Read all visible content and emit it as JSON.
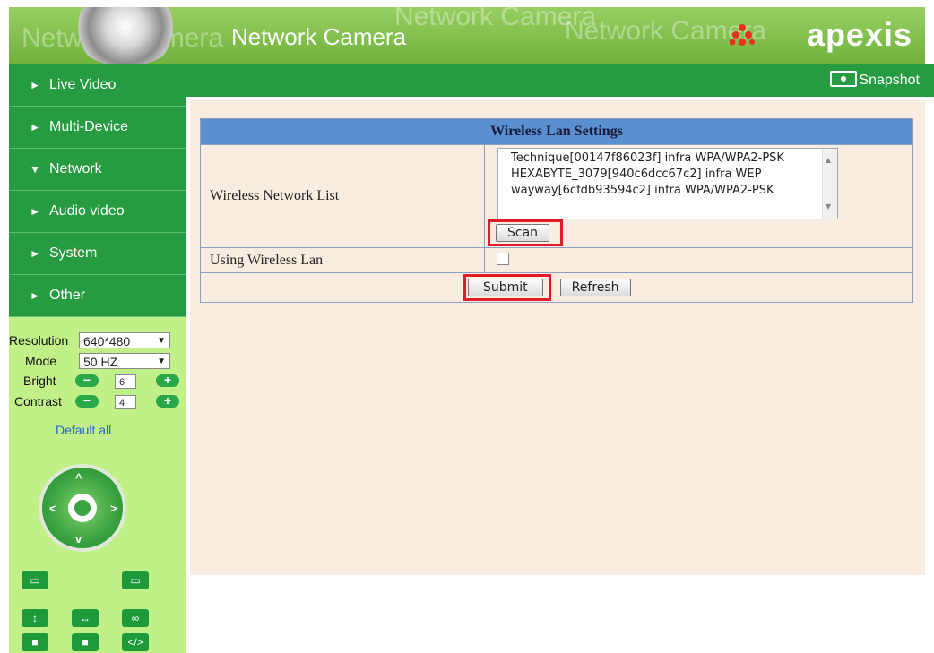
{
  "header": {
    "watermark": "Network Camera",
    "title": "Network Camera",
    "brand": "apexis"
  },
  "sidebar": {
    "items": [
      {
        "label": "Live Video",
        "icon": "triangle-right-icon",
        "arrow": "►"
      },
      {
        "label": "Multi-Device",
        "icon": "triangle-right-icon",
        "arrow": "►"
      },
      {
        "label": "Network",
        "icon": "triangle-down-icon",
        "arrow": "▼"
      },
      {
        "label": "Audio video",
        "icon": "triangle-right-icon",
        "arrow": "►"
      },
      {
        "label": "System",
        "icon": "triangle-right-icon",
        "arrow": "►"
      },
      {
        "label": "Other",
        "icon": "triangle-right-icon",
        "arrow": "►"
      }
    ],
    "controls": {
      "resolution_label": "Resolution",
      "resolution_value": "640*480",
      "mode_label": "Mode",
      "mode_value": "50 HZ",
      "bright_label": "Bright",
      "bright_value": "6",
      "contrast_label": "Contrast",
      "contrast_value": "4",
      "minus": "−",
      "plus": "+",
      "default_all": "Default all"
    }
  },
  "toolbar": {
    "snapshot_label": "Snapshot"
  },
  "panel": {
    "title": "Wireless Lan Settings",
    "wireless_list_label": "Wireless Network List",
    "networks": [
      "Technique[00147f86023f] infra WPA/WPA2-PSK",
      "HEXABYTE_3079[940c6dcc67c2] infra WEP",
      "wayway[6cfdb93594c2] infra WPA/WPA2-PSK"
    ],
    "scan_label": "Scan",
    "using_wlan_label": "Using Wireless Lan",
    "using_wlan_checked": false,
    "submit_label": "Submit",
    "refresh_label": "Refresh"
  },
  "colors": {
    "nav_green": "#279b42",
    "sidebar_bg": "#c1f088",
    "panel_header": "#5a8fd0",
    "main_bg": "#f9ece0",
    "highlight_red": "#e01b2a"
  }
}
